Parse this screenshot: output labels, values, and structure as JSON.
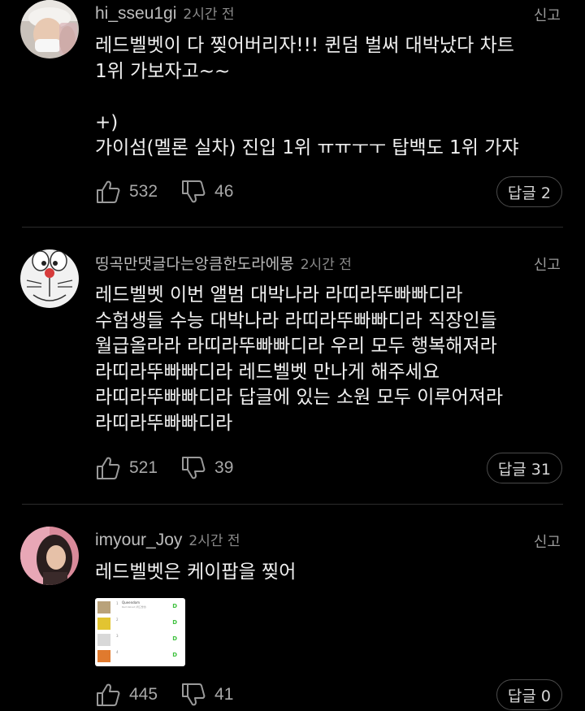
{
  "comments": [
    {
      "username": "hi_sseu1gi",
      "time": "2시간 전",
      "report": "신고",
      "lines": [
        "레드벨벳이 다 찢어버리자!!! 퀸덤 벌써 대박났다 차트",
        "1위 가보자고~~",
        "",
        "+)",
        "가이섬(멜론 실차) 진입 1위 ㅠㅠㅜㅜ 탑백도 1위 가쟈"
      ],
      "likes": "532",
      "dislikes": "46",
      "reply_label": "답글 2"
    },
    {
      "username": "띵곡만댓글다는앙큼한도라에몽",
      "time": "2시간 전",
      "report": "신고",
      "lines": [
        "레드벨벳 이번 앨범 대박나라 라띠라뚜빠빠디라",
        "수험생들 수능 대박나라 라띠라뚜빠빠디라 직장인들",
        "월급올라라 라띠라뚜빠빠디라 우리 모두 행복해져라",
        "라띠라뚜빠빠디라 레드벨벳 만나게 해주세요",
        "라띠라뚜빠빠디라 답글에 있는 소원 모두 이루어져라",
        "라띠라뚜빠빠디라"
      ],
      "likes": "521",
      "dislikes": "39",
      "reply_label": "답글 31"
    },
    {
      "username": "imyour_Joy",
      "time": "2시간 전",
      "report": "신고",
      "lines": [
        "레드벨벳은 케이팝을 찢어"
      ],
      "image": {
        "rows": [
          {
            "rank": "1",
            "title": "Queendom",
            "artist": "Red Velvet (레드벨벳)",
            "art_color": "#b9a27a"
          },
          {
            "rank": "2",
            "title": "",
            "artist": "",
            "art_color": "#e2c431"
          },
          {
            "rank": "3",
            "title": "",
            "artist": "",
            "art_color": "#d8d8d8"
          },
          {
            "rank": "4",
            "title": "",
            "artist": "",
            "art_color": "#e07a2e"
          }
        ],
        "download_glyph": "D"
      },
      "likes": "445",
      "dislikes": "41",
      "reply_label": "답글 0"
    }
  ],
  "colors": {
    "background": "#000000",
    "text": "#f0f0f0",
    "muted": "#8a8a8a",
    "divider": "#2c2c2c"
  },
  "icons": {
    "like": "thumbs-up-outline-icon",
    "dislike": "thumbs-down-outline-icon"
  }
}
